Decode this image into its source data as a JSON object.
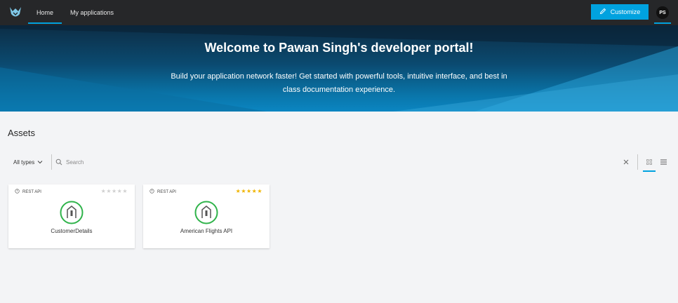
{
  "nav": {
    "tabs": [
      {
        "label": "Home",
        "active": true
      },
      {
        "label": "My applications",
        "active": false
      }
    ],
    "customize_label": "Customize",
    "avatar_initials": "PS",
    "accent_color": "#00a2df"
  },
  "hero": {
    "title": "Welcome to Pawan Singh's developer portal!",
    "subtitle": "Build your application network faster! Get started with powerful tools, intuitive interface, and best in class documentation experience."
  },
  "assets": {
    "title": "Assets",
    "type_filter": "All types",
    "search_placeholder": "Search",
    "cards": [
      {
        "type": "REST API",
        "name": "CustomerDetails",
        "rating": 0,
        "icon": "api-icon"
      },
      {
        "type": "REST API",
        "name": "American Flights API",
        "rating": 5,
        "icon": "api-icon"
      }
    ]
  }
}
